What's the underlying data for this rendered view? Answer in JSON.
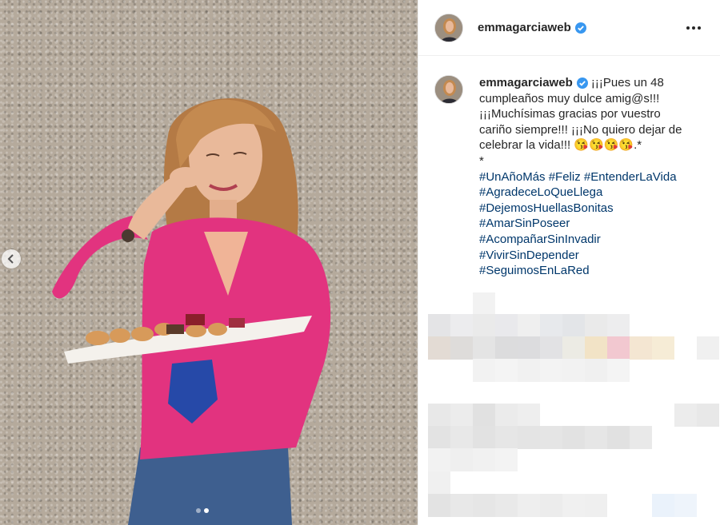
{
  "post": {
    "username": "emmagarciaweb",
    "caption_lines": [
      "¡¡¡Pues un 48",
      "cumpleaños muy dulce amig@s!!!",
      "¡¡¡Muchísimas gracias por vuestro",
      "cariño siempre!!! ¡¡¡No quiero dejar de",
      "celebrar la vida!!! 😘😘😘😘.*"
    ],
    "separator": "*",
    "hashtags": [
      "#UnAñoMás #Feliz #EntenderLaVida",
      "#AgradeceLoQueLlega",
      "#DejemosHuellasBonitas",
      "#AmarSinPoseer",
      "#AcompañarSinInvadir",
      "#VivirSinDepender",
      "#SeguimosEnLaRed"
    ]
  },
  "carousel": {
    "slide_count": 2,
    "active_slide": 2
  },
  "icons": {
    "verified": "verified-badge-icon",
    "more": "more-options-icon",
    "prev": "chevron-left-icon"
  },
  "colors": {
    "verified": "#3897f0",
    "hashtag": "#00376b",
    "shirt": "#e2337f"
  }
}
